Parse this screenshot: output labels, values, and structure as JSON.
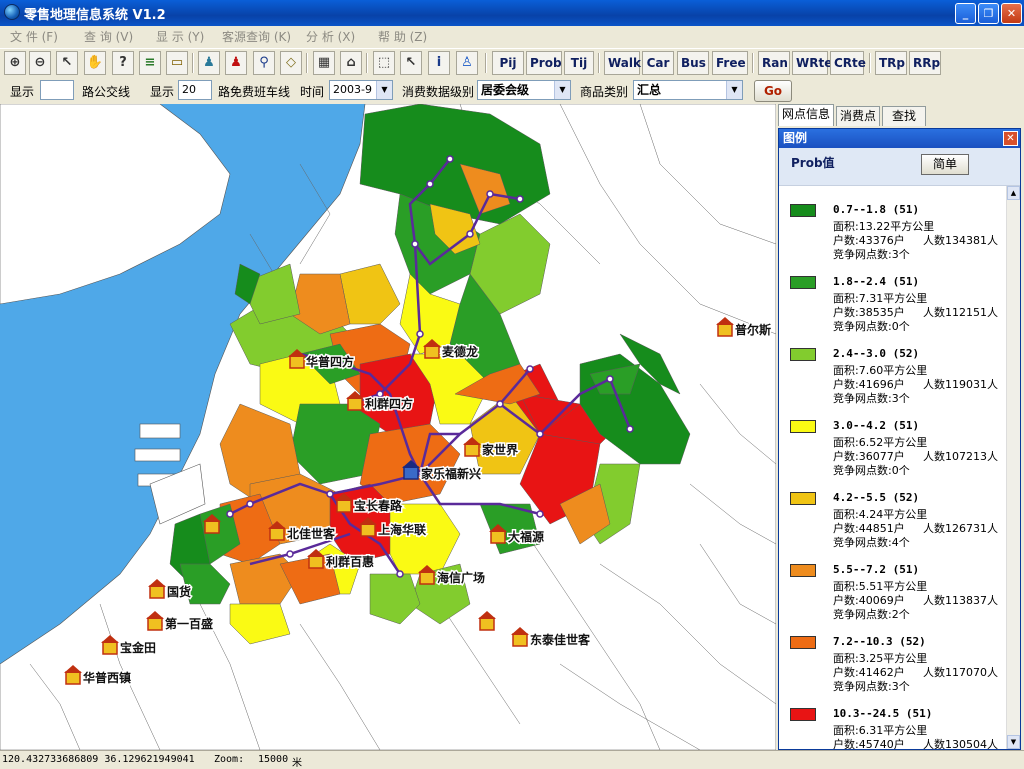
{
  "window": {
    "title": "零售地理信息系统 V1.2",
    "minimize": "_",
    "maximize": "❐",
    "close": "✕"
  },
  "menu": [
    {
      "label": "文 件 (F)"
    },
    {
      "label": "查 询 (V)"
    },
    {
      "label": "显 示 (Y)"
    },
    {
      "label": "客源查询 (K)"
    },
    {
      "label": "分 析 (X)"
    },
    {
      "label": "帮 助 (Z)"
    }
  ],
  "toolbar": {
    "icons": [
      "zoom-in-icon",
      "zoom-out-icon",
      "select-arrow-icon",
      "pan-hand-icon",
      "info-balloon-icon",
      "layers-icon",
      "ruler-icon",
      "green-figure-icon",
      "red-figure-icon",
      "pushpin-icon",
      "eraser-icon",
      "table-icon",
      "building-icon",
      "region-select-icon",
      "pointer-icon",
      "info-icon",
      "person-icon"
    ],
    "text_buttons": [
      "Pij",
      "Prob",
      "Tij",
      "Walk",
      "Car",
      "Bus",
      "Free",
      "Ran",
      "WRte",
      "CRte",
      "TRp",
      "RRp"
    ]
  },
  "options": {
    "show_label_1": "显示",
    "show_value_1": "",
    "route_label": "路公交线",
    "show_label_2": "显示",
    "show_value_2": "20",
    "free_route_label": "路免费班车线",
    "time_label": "时间",
    "time_value": "2003-9",
    "level_label": "消费数据级别",
    "level_value": "居委会级",
    "category_label": "商品类别",
    "category_value": "汇总",
    "go_label": "Go"
  },
  "tabs": [
    "网点信息",
    "消费点",
    "查找"
  ],
  "legend": {
    "window_title": "图例",
    "close": "✕",
    "title": "Prob值",
    "simple_button": "简单",
    "items": [
      {
        "range": "0.7--1.8 (51)",
        "area": "面积:13.22平方公里",
        "households": "户数:43376户",
        "population": "人数134381人",
        "competitors": "竞争网点数:3个",
        "color": "#168c1c"
      },
      {
        "range": "1.8--2.4 (51)",
        "area": "面积:7.31平方公里",
        "households": "户数:38535户",
        "population": "人数112151人",
        "competitors": "竞争网点数:0个",
        "color": "#2a9e26"
      },
      {
        "range": "2.4--3.0 (52)",
        "area": "面积:7.60平方公里",
        "households": "户数:41696户",
        "population": "人数119031人",
        "competitors": "竞争网点数:3个",
        "color": "#82cc2e"
      },
      {
        "range": "3.0--4.2 (51)",
        "area": "面积:6.52平方公里",
        "households": "户数:36077户",
        "population": "人数107213人",
        "competitors": "竞争网点数:0个",
        "color": "#fafa14"
      },
      {
        "range": "4.2--5.5 (52)",
        "area": "面积:4.24平方公里",
        "households": "户数:44851户",
        "population": "人数126731人",
        "competitors": "竞争网点数:4个",
        "color": "#f0c414"
      },
      {
        "range": "5.5--7.2 (51)",
        "area": "面积:5.51平方公里",
        "households": "户数:40069户",
        "population": "人数113837人",
        "competitors": "竞争网点数:2个",
        "color": "#ee8c1e"
      },
      {
        "range": "7.2--10.3 (52)",
        "area": "面积:3.25平方公里",
        "households": "户数:41462户",
        "population": "人数117070人",
        "competitors": "竞争网点数:3个",
        "color": "#ee6c14"
      },
      {
        "range": "10.3--24.5 (51)",
        "area": "面积:6.31平方公里",
        "households": "户数:45740户",
        "population": "人数130504人",
        "competitors": "",
        "color": "#e81414"
      }
    ]
  },
  "map": {
    "stores": [
      {
        "name": "华普四方"
      },
      {
        "name": "麦德龙"
      },
      {
        "name": "利群四方"
      },
      {
        "name": "家世界"
      },
      {
        "name": "家乐福新兴"
      },
      {
        "name": "宝长春路"
      },
      {
        "name": "上海华联"
      },
      {
        "name": "北佳世客"
      },
      {
        "name": "利群百惠"
      },
      {
        "name": "大福源"
      },
      {
        "name": "海信广场"
      },
      {
        "name": "国货"
      },
      {
        "name": "第一百盛"
      },
      {
        "name": "宝金田"
      },
      {
        "name": "华普西镇"
      },
      {
        "name": "东泰佳世客"
      },
      {
        "name": "普尔斯"
      }
    ]
  },
  "status": {
    "coords": "120.432733686809  36.129621949041",
    "zoom_label": "Zoom:",
    "zoom_value": "15000",
    "unit": "米"
  }
}
